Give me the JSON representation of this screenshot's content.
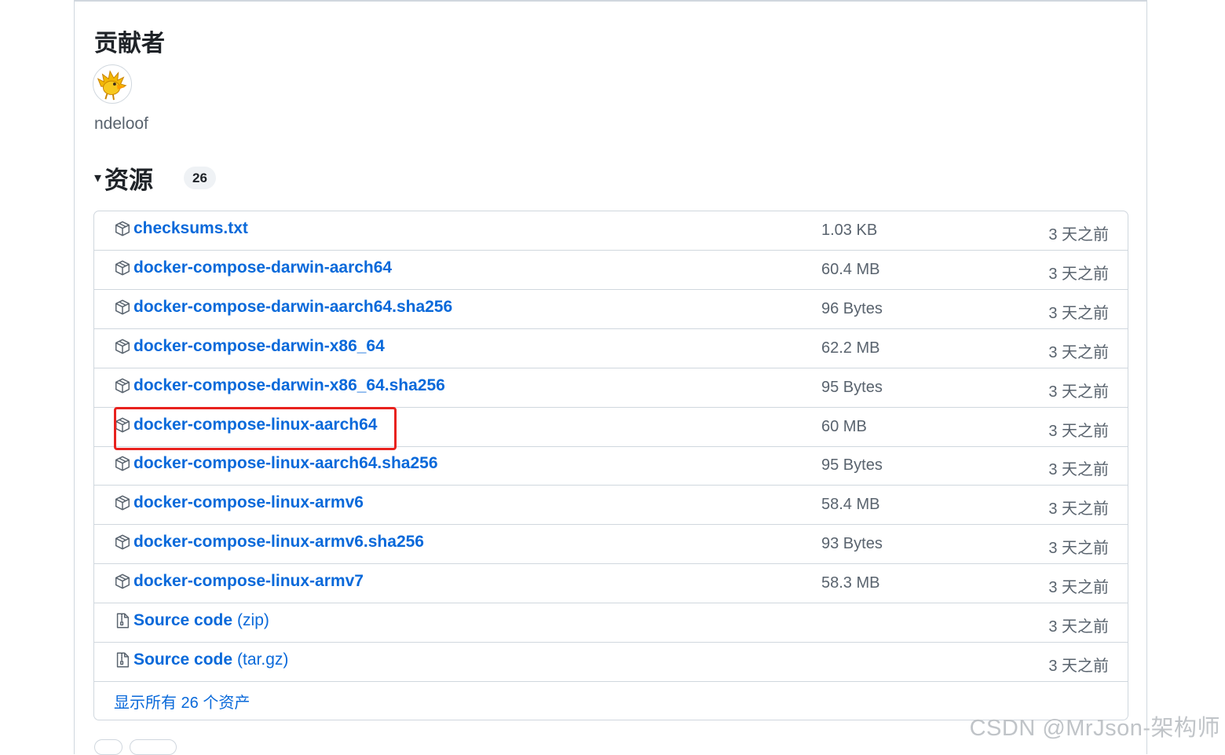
{
  "contributors": {
    "title": "贡献者",
    "users": [
      {
        "name": "ndeloof"
      }
    ]
  },
  "assets": {
    "caret": "▾",
    "title": "资源",
    "count": "26",
    "rows": [
      {
        "name": "checksums.txt",
        "suffix": "",
        "size": "1.03 KB",
        "date": "3 天之前",
        "icon": "package-icon"
      },
      {
        "name": "docker-compose-darwin-aarch64",
        "suffix": "",
        "size": "60.4 MB",
        "date": "3 天之前",
        "icon": "package-icon"
      },
      {
        "name": "docker-compose-darwin-aarch64.sha256",
        "suffix": "",
        "size": "96 Bytes",
        "date": "3 天之前",
        "icon": "package-icon"
      },
      {
        "name": "docker-compose-darwin-x86_64",
        "suffix": "",
        "size": "62.2 MB",
        "date": "3 天之前",
        "icon": "package-icon"
      },
      {
        "name": "docker-compose-darwin-x86_64.sha256",
        "suffix": "",
        "size": "95 Bytes",
        "date": "3 天之前",
        "icon": "package-icon"
      },
      {
        "name": "docker-compose-linux-aarch64",
        "suffix": "",
        "size": "60 MB",
        "date": "3 天之前",
        "icon": "package-icon"
      },
      {
        "name": "docker-compose-linux-aarch64.sha256",
        "suffix": "",
        "size": "95 Bytes",
        "date": "3 天之前",
        "icon": "package-icon"
      },
      {
        "name": "docker-compose-linux-armv6",
        "suffix": "",
        "size": "58.4 MB",
        "date": "3 天之前",
        "icon": "package-icon"
      },
      {
        "name": "docker-compose-linux-armv6.sha256",
        "suffix": "",
        "size": "93 Bytes",
        "date": "3 天之前",
        "icon": "package-icon"
      },
      {
        "name": "docker-compose-linux-armv7",
        "suffix": "",
        "size": "58.3 MB",
        "date": "3 天之前",
        "icon": "package-icon"
      },
      {
        "name": "Source code",
        "suffix": "(zip)",
        "size": "",
        "date": "3 天之前",
        "icon": "file-zip-icon"
      },
      {
        "name": "Source code",
        "suffix": "(tar.gz)",
        "size": "",
        "date": "3 天之前",
        "icon": "file-zip-icon"
      }
    ],
    "show_all": "显示所有 26 个资产"
  },
  "watermark": "CSDN @MrJson-架构师",
  "colors": {
    "link": "#0969da",
    "muted": "#59636e",
    "border": "#d0d7de",
    "highlight": "#e8221e"
  }
}
